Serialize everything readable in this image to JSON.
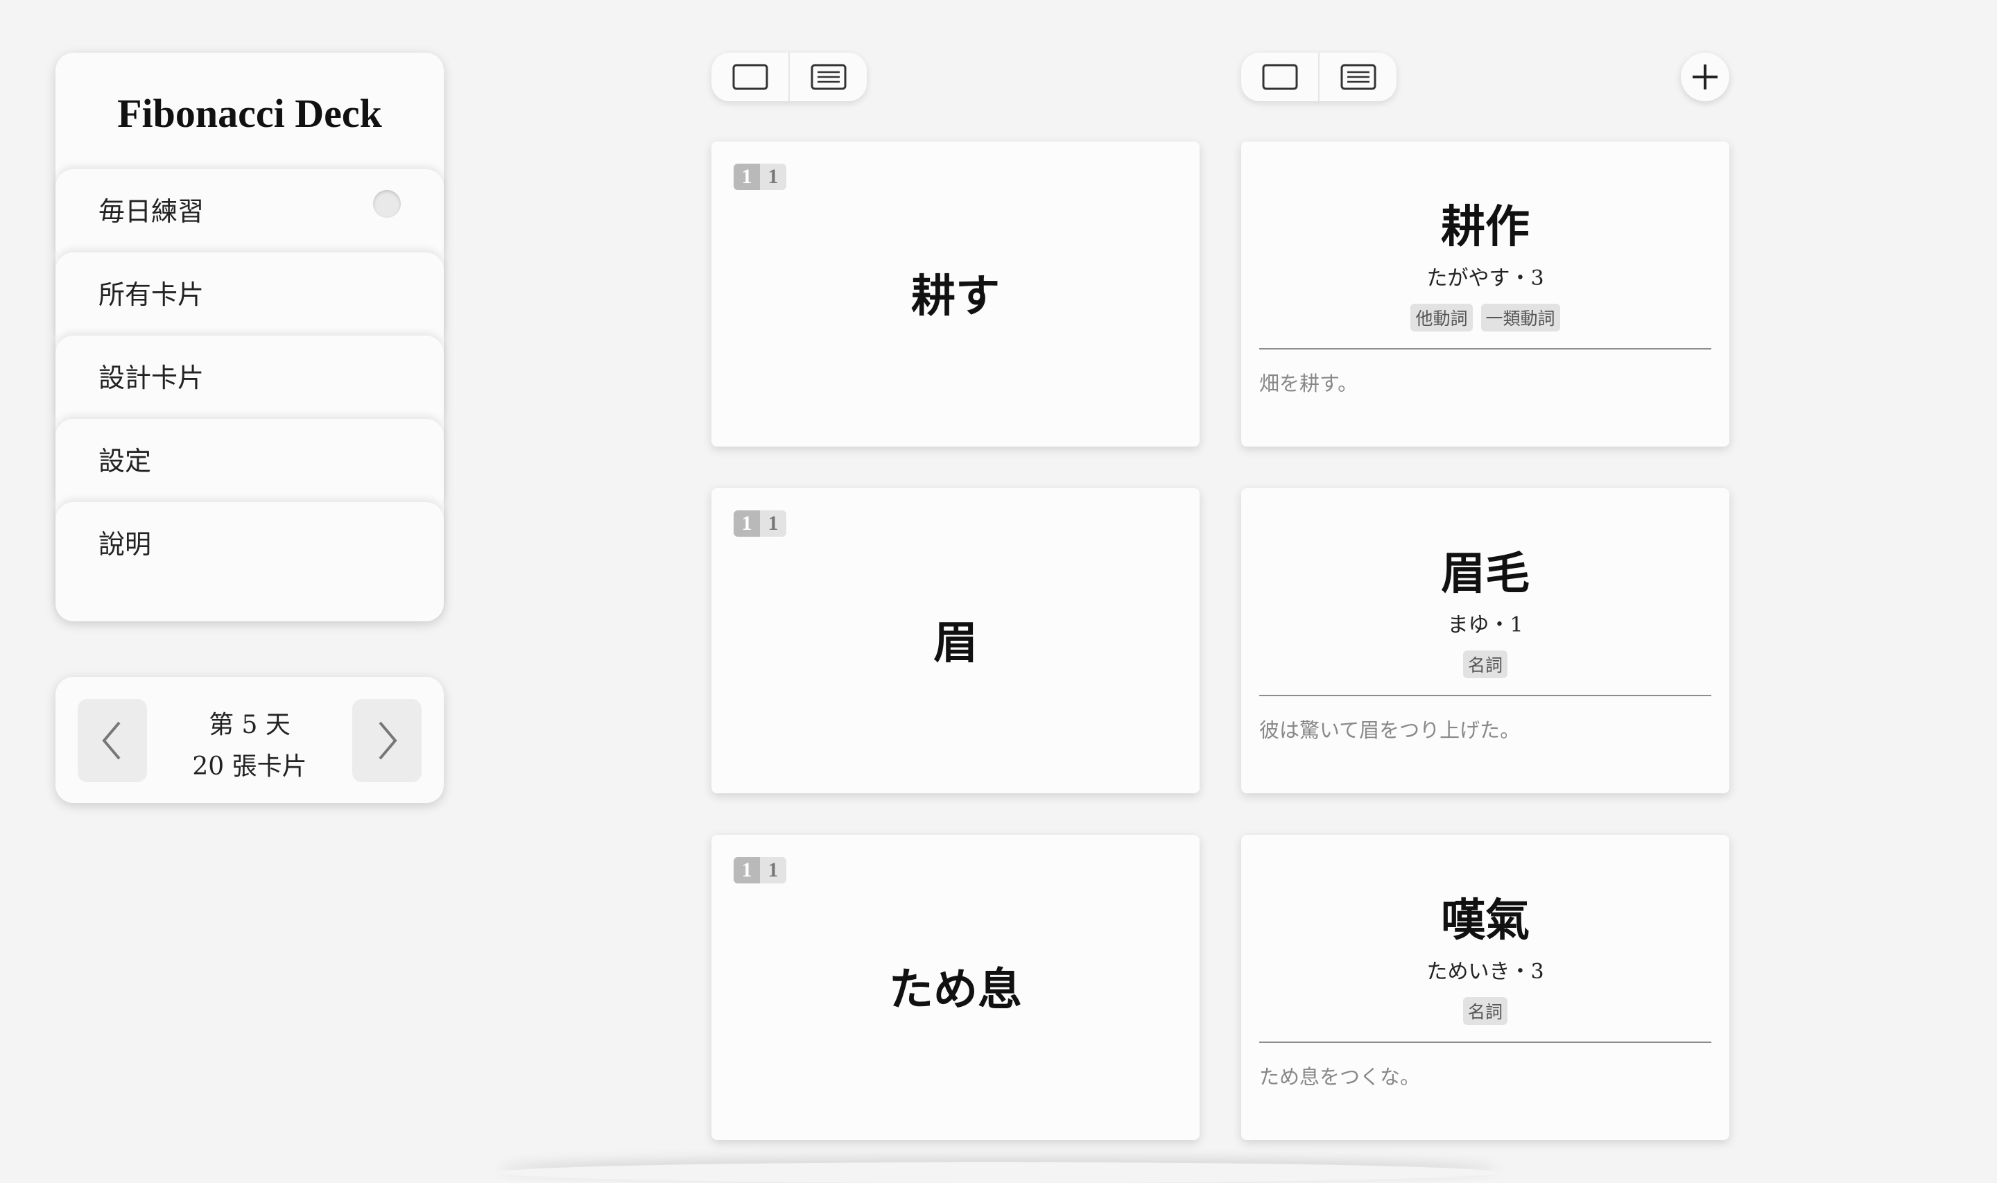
{
  "sidebar": {
    "title": "Fibonacci Deck",
    "items": [
      {
        "label": "毎日練習"
      },
      {
        "label": "所有卡片"
      },
      {
        "label": "設計卡片"
      },
      {
        "label": "設定"
      },
      {
        "label": "說明"
      }
    ]
  },
  "day_panel": {
    "day_label": "第 5 天",
    "card_count": "20 張卡片"
  },
  "cards": [
    {
      "badge": [
        "1",
        "1"
      ],
      "front": "耕す",
      "back": {
        "word": "耕作",
        "reading": "たがやす・3",
        "tags": [
          "他動詞",
          "一類動詞"
        ],
        "example": "畑を耕す。"
      }
    },
    {
      "badge": [
        "1",
        "1"
      ],
      "front": "眉",
      "back": {
        "word": "眉毛",
        "reading": "まゆ・1",
        "tags": [
          "名詞"
        ],
        "example": "彼は驚いて眉をつり上げた。"
      }
    },
    {
      "badge": [
        "1",
        "1"
      ],
      "front": "ため息",
      "back": {
        "word": "嘆氣",
        "reading": "ためいき・3",
        "tags": [
          "名詞"
        ],
        "example": "ため息をつくな。"
      }
    }
  ],
  "icons": {
    "toggle": "toggle-icon",
    "prev": "chevron-left-icon",
    "next": "chevron-right-icon",
    "card_view": "card-view-icon",
    "text_view": "text-view-icon",
    "add": "plus-icon"
  }
}
